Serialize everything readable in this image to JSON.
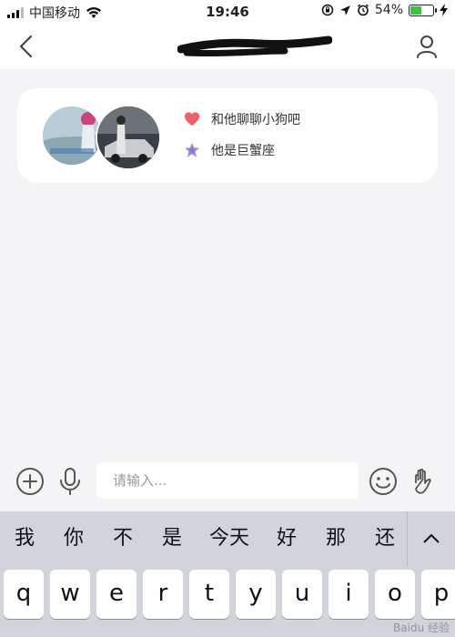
{
  "status_bar": {
    "carrier": "中国移动",
    "time": "19:46",
    "battery": "54%",
    "battery_level": 0.54
  },
  "nav": {
    "title": ""
  },
  "card": {
    "tips": [
      {
        "icon": "heart-icon",
        "text": "和他聊聊小狗吧"
      },
      {
        "icon": "star-icon",
        "text": "他是巨蟹座"
      }
    ]
  },
  "input": {
    "placeholder": "请输入..."
  },
  "keyboard": {
    "suggestions": [
      "我",
      "你",
      "不",
      "是",
      "今天",
      "好",
      "那",
      "还"
    ],
    "keys": [
      "q",
      "w",
      "e",
      "r",
      "t",
      "y",
      "u",
      "i",
      "o",
      "p"
    ]
  },
  "colors": {
    "accent_purple": "#8a6fd6",
    "heart_red": "#f0606a",
    "battery_green": "#37c53f"
  },
  "watermark": "Baidu 经验"
}
